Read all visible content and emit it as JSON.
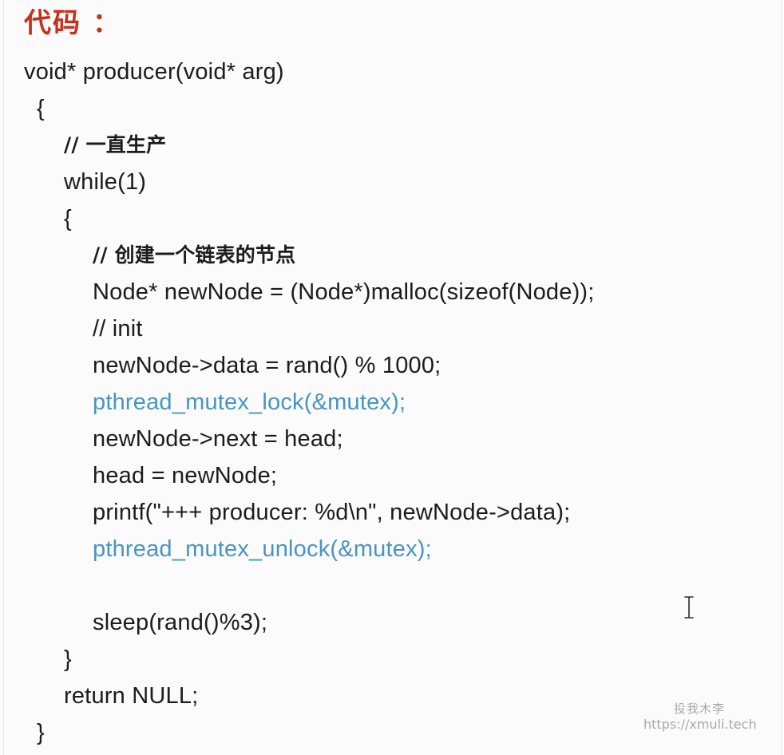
{
  "heading": "代码 ：",
  "code": {
    "line1": "void* producer(void* arg)",
    "line2": "{",
    "line3": "// 一直生产",
    "line4": "while(1)",
    "line5": "{",
    "line6": "// 创建一个链表的节点",
    "line7": "Node* newNode = (Node*)malloc(sizeof(Node));",
    "line8": "// init",
    "line9": "newNode->data = rand() % 1000;",
    "line10": "pthread_mutex_lock(&mutex);",
    "line11": "newNode->next = head;",
    "line12": "head = newNode;",
    "line13": "printf(\"+++ producer: %d\\n\", newNode->data);",
    "line14": "pthread_mutex_unlock(&mutex);",
    "line15": "sleep(rand()%3);",
    "line16": "}",
    "line17": "return NULL;",
    "line18": "}"
  },
  "watermark": {
    "name": "投我木李",
    "url": "https://xmuli.tech"
  },
  "colors": {
    "heading": "#c4321e",
    "code": "#1c1c1c",
    "highlight": "#4a95bf",
    "watermark": "#a8a8a8"
  },
  "icons": {
    "cursor": "text-cursor-icon"
  }
}
